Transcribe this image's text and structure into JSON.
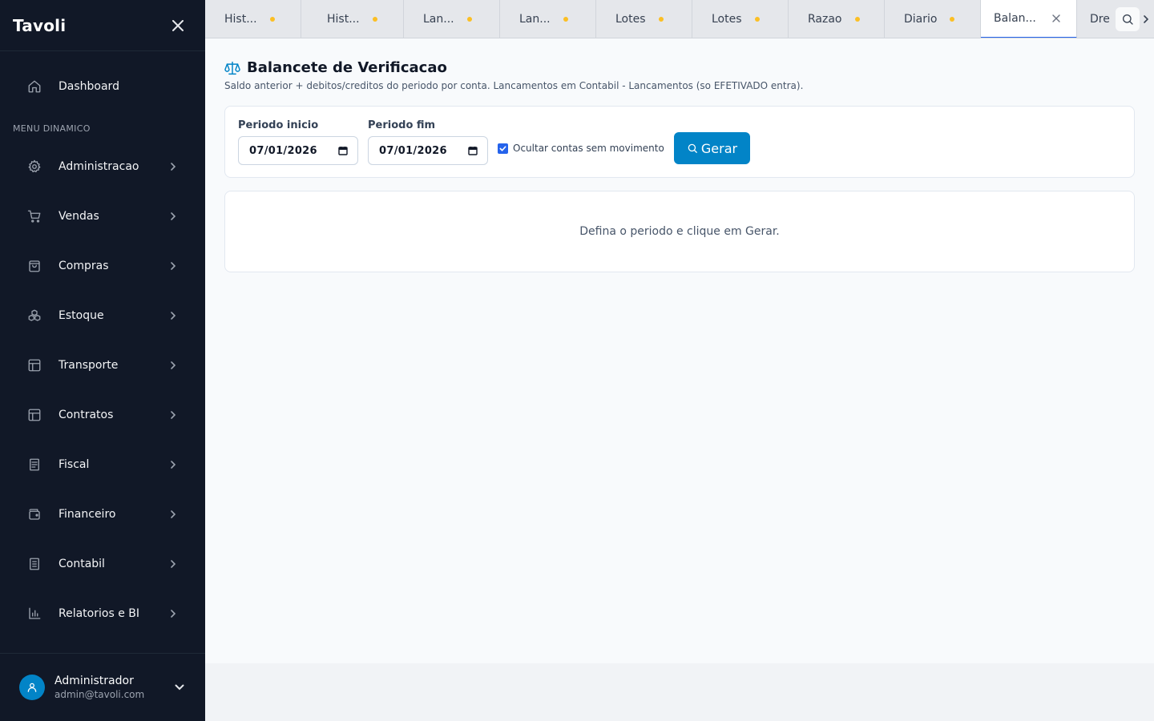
{
  "sidebar": {
    "brand": "Tavoli",
    "dashboard_label": "Dashboard",
    "section_label": "MENU DINAMICO",
    "items": [
      {
        "label": "Administracao",
        "icon": "gear-icon"
      },
      {
        "label": "Vendas",
        "icon": "cart-icon"
      },
      {
        "label": "Compras",
        "icon": "shopping-bag-icon"
      },
      {
        "label": "Estoque",
        "icon": "boxes-icon"
      },
      {
        "label": "Transporte",
        "icon": "layout-icon"
      },
      {
        "label": "Contratos",
        "icon": "layout-icon"
      },
      {
        "label": "Fiscal",
        "icon": "receipt-icon"
      },
      {
        "label": "Financeiro",
        "icon": "wallet-icon"
      },
      {
        "label": "Contabil",
        "icon": "book-icon"
      },
      {
        "label": "Relatorios e BI",
        "icon": "bar-chart-icon"
      }
    ],
    "user": {
      "name": "Administrador",
      "email": "admin@tavoli.com"
    }
  },
  "tabs": [
    {
      "label": "Hist..."
    },
    {
      "label": "Hist..."
    },
    {
      "label": "Lan..."
    },
    {
      "label": "Lan..."
    },
    {
      "label": "Lotes"
    },
    {
      "label": "Lotes"
    },
    {
      "label": "Razao"
    },
    {
      "label": "Diario"
    },
    {
      "label": "Balan...",
      "active": true
    },
    {
      "label": "Dre"
    }
  ],
  "page": {
    "title": "Balancete de Verificacao",
    "subtitle": "Saldo anterior + debitos/creditos do periodo por conta. Lancamentos em Contabil - Lancamentos (so EFETIVADO entra).",
    "start_label": "Periodo inicio",
    "start_value": "07/01/2026",
    "end_label": "Periodo fim",
    "end_value": "07/01/2026",
    "hide_label": "Ocultar contas sem movimento",
    "hide_checked": true,
    "gerar_label": "Gerar",
    "empty_message": "Defina o periodo e clique em Gerar."
  },
  "colors": {
    "sidebar_bg": "#111827",
    "accent": "#0284c7",
    "tab_active_border": "#2563eb",
    "tab_dot": "#fbbf24"
  }
}
